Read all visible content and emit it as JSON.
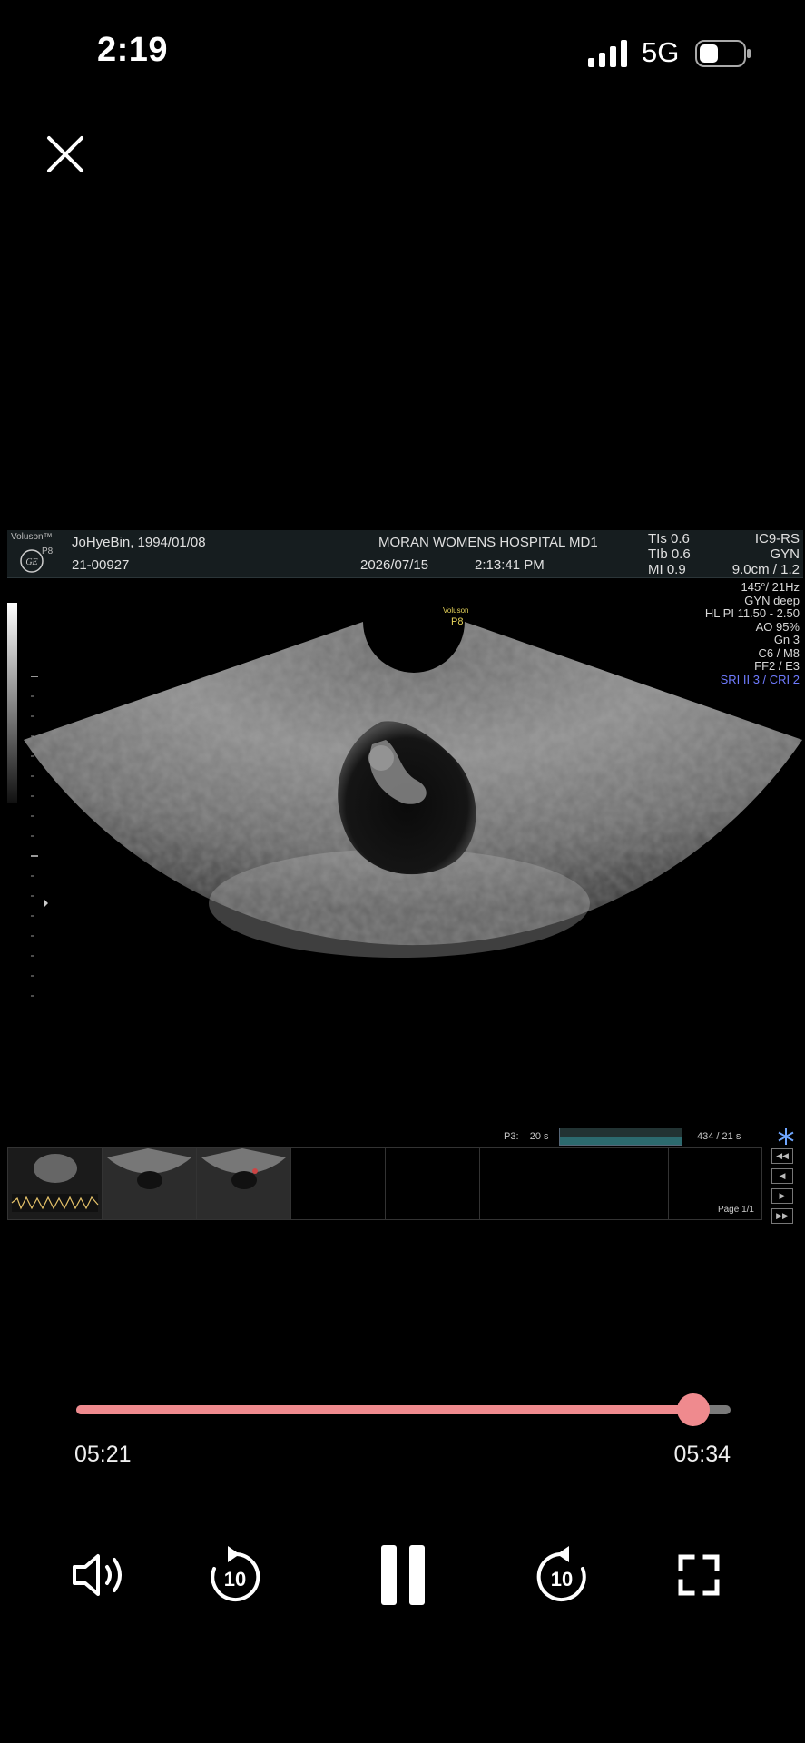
{
  "status": {
    "time": "2:19",
    "network": "5G"
  },
  "ultrasound": {
    "brand": "Voluson™",
    "model": "P8",
    "patient": "JoHyeBin,  1994/01/08",
    "patient_id": "21-00927",
    "hospital": "MORAN WOMENS HOSPITAL  MD1",
    "date": "2026/07/15",
    "time": "2:13:41 PM",
    "tis": "TIs 0.6",
    "tib": "TIb 0.6",
    "mi": "MI  0.9",
    "probe": "IC9-RS",
    "app": "GYN",
    "depth": "9.0cm / 1.2",
    "params": [
      "145°/ 21Hz",
      "GYN deep",
      "HL PI 11.50 - 2.50",
      "AO 95%",
      "Gn  3",
      "C6 / M8",
      "FF2 / E3"
    ],
    "sri": "SRI II 3 / CRI 2",
    "center_logo_1": "Voluson",
    "center_logo_2": "P8",
    "cine_label": "P3:",
    "cine_time": "20 s",
    "cine_frames": "434 / 21 s",
    "page": "Page 1/1"
  },
  "player": {
    "elapsed": "05:21",
    "total": "05:34",
    "progress_fraction": 0.943,
    "skip_back_label": "10",
    "skip_forward_label": "10",
    "accent": "#ef8a8e"
  },
  "icons": [
    "close-icon",
    "volume-icon",
    "rewind-10-icon",
    "pause-icon",
    "forward-10-icon",
    "fullscreen-icon"
  ]
}
